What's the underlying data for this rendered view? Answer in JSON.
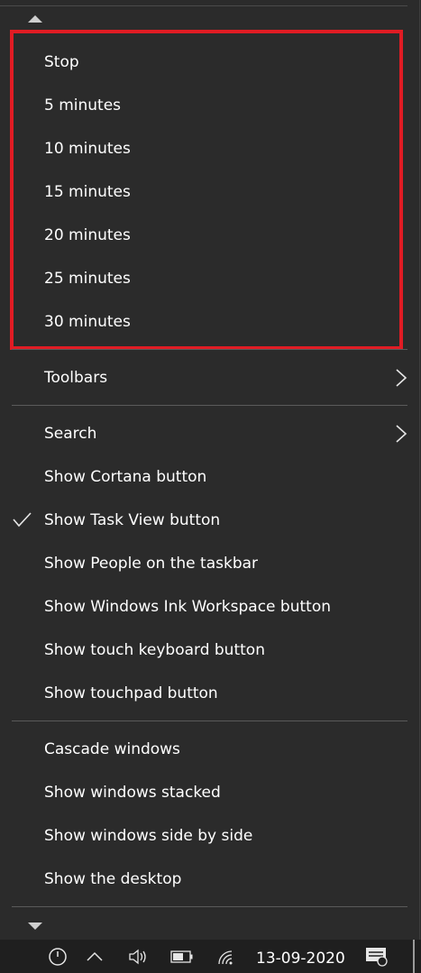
{
  "submenu": {
    "items": [
      "Stop",
      "5 minutes",
      "10 minutes",
      "15 minutes",
      "20 minutes",
      "25 minutes",
      "30 minutes"
    ]
  },
  "menu": {
    "toolbars": "Toolbars",
    "search": "Search",
    "show_cortana": "Show Cortana button",
    "show_task_view": "Show Task View button",
    "show_people": "Show People on the taskbar",
    "show_ink": "Show Windows Ink Workspace button",
    "show_touch_keyboard": "Show touch keyboard button",
    "show_touchpad": "Show touchpad button",
    "cascade": "Cascade windows",
    "stacked": "Show windows stacked",
    "side_by_side": "Show windows side by side",
    "show_desktop": "Show the desktop"
  },
  "taskbar": {
    "date": "13-09-2020",
    "icons": [
      "timer-icon",
      "chevron-up-icon",
      "volume-icon",
      "battery-icon",
      "wifi-icon",
      "notification-icon"
    ]
  },
  "colors": {
    "menu_bg": "#2b2b2b",
    "highlight_border": "#e01c24",
    "taskbar_bg": "#1f1f1f",
    "text": "#ffffff"
  }
}
